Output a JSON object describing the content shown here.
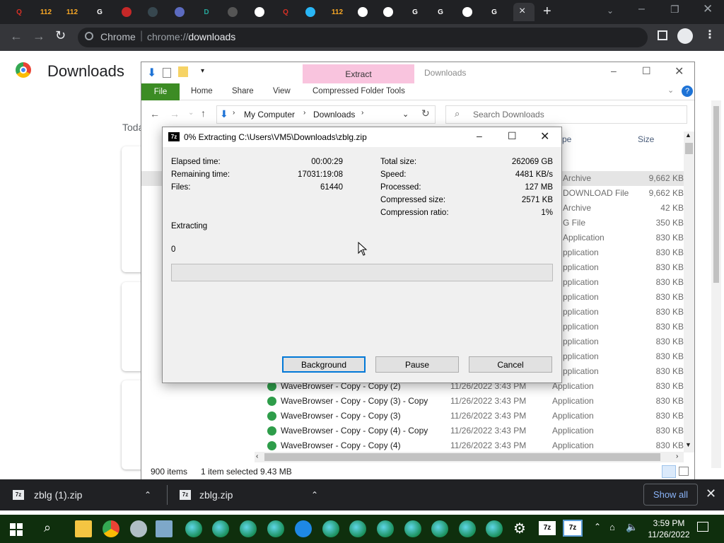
{
  "browser": {
    "omnibox_chip": "Chrome",
    "omnibox_url_prefix": "chrome://",
    "omnibox_url_path": "downloads",
    "tabs": [
      {
        "label": "Q",
        "color": "#d93025"
      },
      {
        "label": "112",
        "color": "#f9a825"
      },
      {
        "label": "112",
        "color": "#f9a825"
      },
      {
        "label": "G",
        "color": "#ffffff"
      },
      {
        "label": "",
        "color": "#c62828"
      },
      {
        "label": "",
        "color": "#37474f"
      },
      {
        "label": "",
        "color": "#5c6bc0"
      },
      {
        "label": "D",
        "color": "#26a69a"
      },
      {
        "label": "",
        "color": "#555555"
      },
      {
        "label": "",
        "color": "#ffffff"
      },
      {
        "label": "Q",
        "color": "#d93025"
      },
      {
        "label": "",
        "color": "#29b6f6"
      },
      {
        "label": "112",
        "color": "#f9a825"
      },
      {
        "label": "",
        "color": "#ffffff"
      },
      {
        "label": "",
        "color": "#ffffff"
      },
      {
        "label": "G",
        "color": "#ffffff"
      },
      {
        "label": "G",
        "color": "#ffffff"
      },
      {
        "label": "",
        "color": "#ffffff"
      },
      {
        "label": "G",
        "color": "#ffffff"
      }
    ]
  },
  "downloads_page": {
    "title": "Downloads",
    "section_label": "Toda"
  },
  "explorer": {
    "window_title": "Downloads",
    "contextual_tab": "Extract",
    "tabs": [
      "File",
      "Home",
      "Share",
      "View",
      "Compressed Folder Tools"
    ],
    "breadcrumb": [
      "My Computer",
      "Downloads"
    ],
    "search_placeholder": "Search Downloads",
    "col_type_header": "pe",
    "col_size_header": "Size",
    "rows_partial": [
      {
        "type": "Archive",
        "size": "9,662 KB"
      },
      {
        "type": "DOWNLOAD File",
        "size": "9,662 KB"
      },
      {
        "type": "Archive",
        "size": "42 KB"
      },
      {
        "type": "G File",
        "size": "350 KB"
      },
      {
        "type": "Application",
        "size": "830 KB"
      },
      {
        "type": "pplication",
        "size": "830 KB"
      },
      {
        "type": "pplication",
        "size": "830 KB"
      },
      {
        "type": "pplication",
        "size": "830 KB"
      },
      {
        "type": "pplication",
        "size": "830 KB"
      },
      {
        "type": "pplication",
        "size": "830 KB"
      },
      {
        "type": "pplication",
        "size": "830 KB"
      },
      {
        "type": "pplication",
        "size": "830 KB"
      },
      {
        "type": "pplication",
        "size": "830 KB"
      },
      {
        "type": "pplication",
        "size": "830 KB"
      }
    ],
    "rows_full": [
      {
        "name": "WaveBrowser - Copy - Copy (2)",
        "date": "11/26/2022 3:43 PM",
        "type": "Application",
        "size": "830 KB"
      },
      {
        "name": "WaveBrowser - Copy - Copy (3) - Copy",
        "date": "11/26/2022 3:43 PM",
        "type": "Application",
        "size": "830 KB"
      },
      {
        "name": "WaveBrowser - Copy - Copy (3)",
        "date": "11/26/2022 3:43 PM",
        "type": "Application",
        "size": "830 KB"
      },
      {
        "name": "WaveBrowser - Copy - Copy (4) - Copy",
        "date": "11/26/2022 3:43 PM",
        "type": "Application",
        "size": "830 KB"
      },
      {
        "name": "WaveBrowser - Copy - Copy (4)",
        "date": "11/26/2022 3:43 PM",
        "type": "Application",
        "size": "830 KB"
      }
    ],
    "status_items": "900 items",
    "status_selected": "1 item selected  9.43 MB"
  },
  "dialog": {
    "title": "0% Extracting C:\\Users\\VM5\\Downloads\\zblg.zip",
    "elapsed_label": "Elapsed time:",
    "elapsed_value": "00:00:29",
    "remaining_label": "Remaining time:",
    "remaining_value": "17031:19:08",
    "files_label": "Files:",
    "files_value": "61440",
    "total_label": "Total size:",
    "total_value": "262069 GB",
    "speed_label": "Speed:",
    "speed_value": "4481 KB/s",
    "processed_label": "Processed:",
    "processed_value": "127 MB",
    "compressed_label": "Compressed size:",
    "compressed_value": "2571 KB",
    "ratio_label": "Compression ratio:",
    "ratio_value": "1%",
    "status_text": "Extracting",
    "current_file": "0",
    "progress": 0,
    "btn_background": "Background",
    "btn_pause": "Pause",
    "btn_cancel": "Cancel"
  },
  "download_bar": {
    "items": [
      "zblg (1).zip",
      "zblg.zip"
    ],
    "show_all": "Show all"
  },
  "taskbar": {
    "time": "3:59 PM",
    "date": "11/26/2022"
  }
}
